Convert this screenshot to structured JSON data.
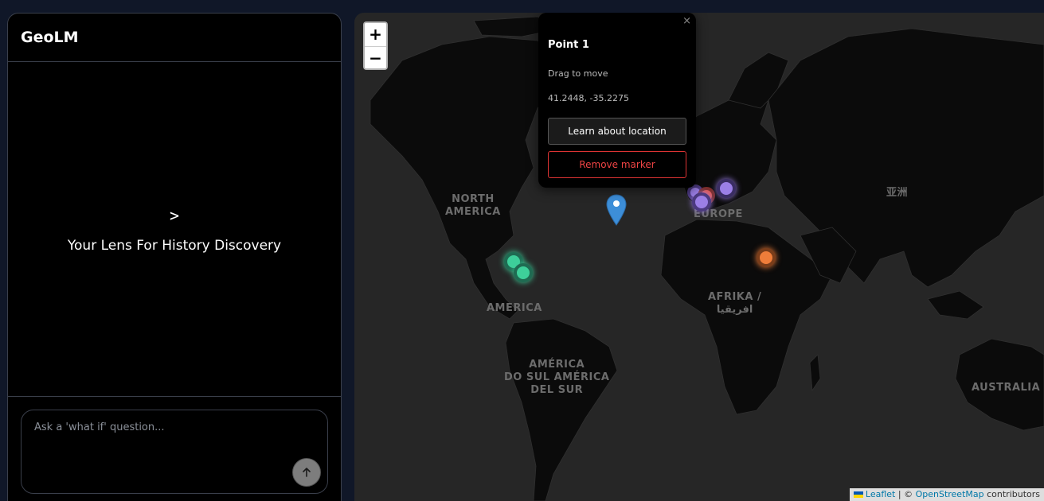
{
  "app": {
    "brand": "GeoLM"
  },
  "hero": {
    "icon": ">",
    "tagline": "Your Lens For History Discovery"
  },
  "chat": {
    "placeholder": "Ask a 'what if' question...",
    "send_icon": "arrow-up-icon"
  },
  "map": {
    "zoom_in": "+",
    "zoom_out": "−",
    "labels": {
      "north_america": "NORTH\nAMERICA",
      "america": "AMERICA",
      "south_america": "AMÉRICA\nDO SUL AMÉRICA\nDEL SUR",
      "europe": "EUROPE",
      "africa": "AFRIKA /\nافريقيا",
      "asia": "亚洲",
      "australia": "AUSTRALIA"
    },
    "marker_colors": {
      "green": "#3ecf9a",
      "purple": "#9b7fe6",
      "red": "#e0584e",
      "orange": "#ef7d3a",
      "pin": "#3d8ed8"
    },
    "attribution": {
      "leaflet": "Leaflet",
      "sep": " | © ",
      "osm": "OpenStreetMap",
      "suffix": " contributors"
    }
  },
  "popup": {
    "close": "×",
    "title": "Point 1",
    "subtitle": "Drag to move",
    "coords": "41.2448, -35.2275",
    "learn_button": "Learn about location",
    "remove_button": "Remove marker"
  }
}
